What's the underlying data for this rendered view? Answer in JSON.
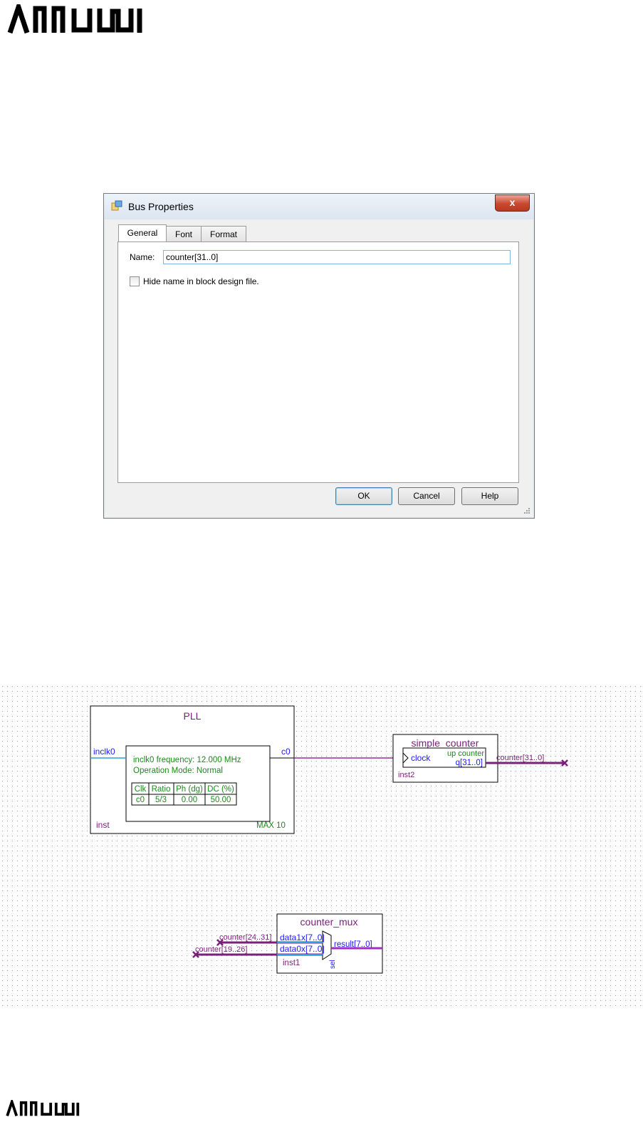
{
  "logo": {
    "text": "ARROW"
  },
  "dialog": {
    "title": "Bus Properties",
    "close_label": "x",
    "tabs": [
      "General",
      "Font",
      "Format"
    ],
    "name_label": "Name:",
    "name_value": "counter[31..0]",
    "hide_name_label": "Hide name in block design file.",
    "ok_label": "OK",
    "cancel_label": "Cancel",
    "help_label": "Help"
  },
  "schematic": {
    "pll": {
      "title": "PLL",
      "input": "inclk0",
      "output": "c0",
      "freq": "inclk0 frequency: 12.000 MHz",
      "mode": "Operation Mode: Normal",
      "table_headers": [
        "Clk",
        "Ratio",
        "Ph (dg)",
        "DC (%)"
      ],
      "table_row": [
        "c0",
        "5/3",
        "0.00",
        "50.00"
      ],
      "inst": "inst",
      "device": "MAX 10"
    },
    "counter": {
      "title": "simple_counter",
      "clock": "clock",
      "type": "up counter",
      "q": "q[31..0]",
      "inst": "inst2",
      "bus": "counter[31..0]"
    },
    "mux": {
      "title": "counter_mux",
      "data1": "data1x[7..0]",
      "data0": "data0x[7..0]",
      "result": "result[7..0]",
      "sel": "sel",
      "inst": "inst1",
      "bus1": "counter[24..31]",
      "bus0": "counter[19..26]"
    }
  },
  "colors": {
    "purple": "#7a1f7a",
    "blue": "#1a1aff",
    "green": "#1a8a1a",
    "cyan": "#2aa0d8"
  }
}
